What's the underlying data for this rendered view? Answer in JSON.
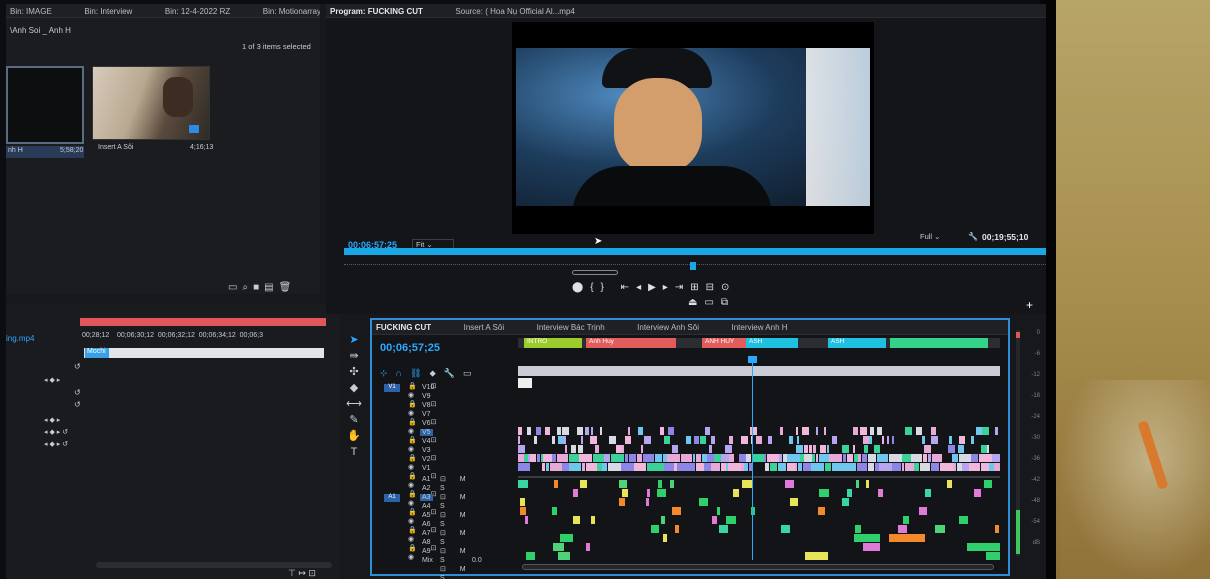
{
  "project_panel": {
    "tabs": [
      "Bin: IMAGE",
      "Bin: Interview",
      "Bin: 12-4-2022 RZ",
      "Bin: Motionarray"
    ],
    "path": "\\Anh Soi _ Anh H",
    "selection": "1 of 3 items selected",
    "items": [
      {
        "name": "nh H",
        "duration": "5;58;20"
      },
      {
        "name": "Insert A Sôi",
        "duration": "4;16;13"
      }
    ]
  },
  "program_monitor": {
    "title": "Program: FUCKING CUT",
    "source": "Source: ( Hoa Nụ Official Al...mp4",
    "timecode": "00;06;57;25",
    "fit": "Fit",
    "quality": "Full",
    "duration": "00;19;55;10"
  },
  "source_timeline": {
    "file": "ing.mp4",
    "times": [
      "00;28;12",
      "00;06;30;12",
      "00;06;32;12",
      "00;06;34;12",
      "00;06;3"
    ],
    "clip": "Mochi"
  },
  "timeline": {
    "tabs": [
      "FUCKING CUT",
      "Insert A Sôi",
      "Interview Bác Trịnh",
      "Interview Anh Sôi",
      "Interview Anh H"
    ],
    "timecode": "00;06;57;25",
    "markers": [
      "INTRO",
      "Anh Huy",
      "ANH HUY",
      "ASH",
      "ASH"
    ],
    "video_tracks": [
      "V10",
      "V9",
      "V8",
      "V7",
      "V6",
      "V5",
      "V4",
      "V3",
      "V2",
      "V1"
    ],
    "audio_tracks": [
      "A1",
      "A2",
      "A3",
      "A4",
      "A5",
      "A6",
      "A7",
      "A8",
      "A9"
    ],
    "mix_label": "Mix",
    "mix_value": "0.0"
  },
  "vu_meter": [
    "0",
    "-6",
    "-12",
    "-18",
    "-24",
    "-30",
    "-36",
    "-42",
    "-48",
    "-54",
    "dB"
  ],
  "colors": {
    "accent": "#1aa7e6",
    "panel": "#17181b",
    "highlight_border": "#2e8fd6"
  }
}
